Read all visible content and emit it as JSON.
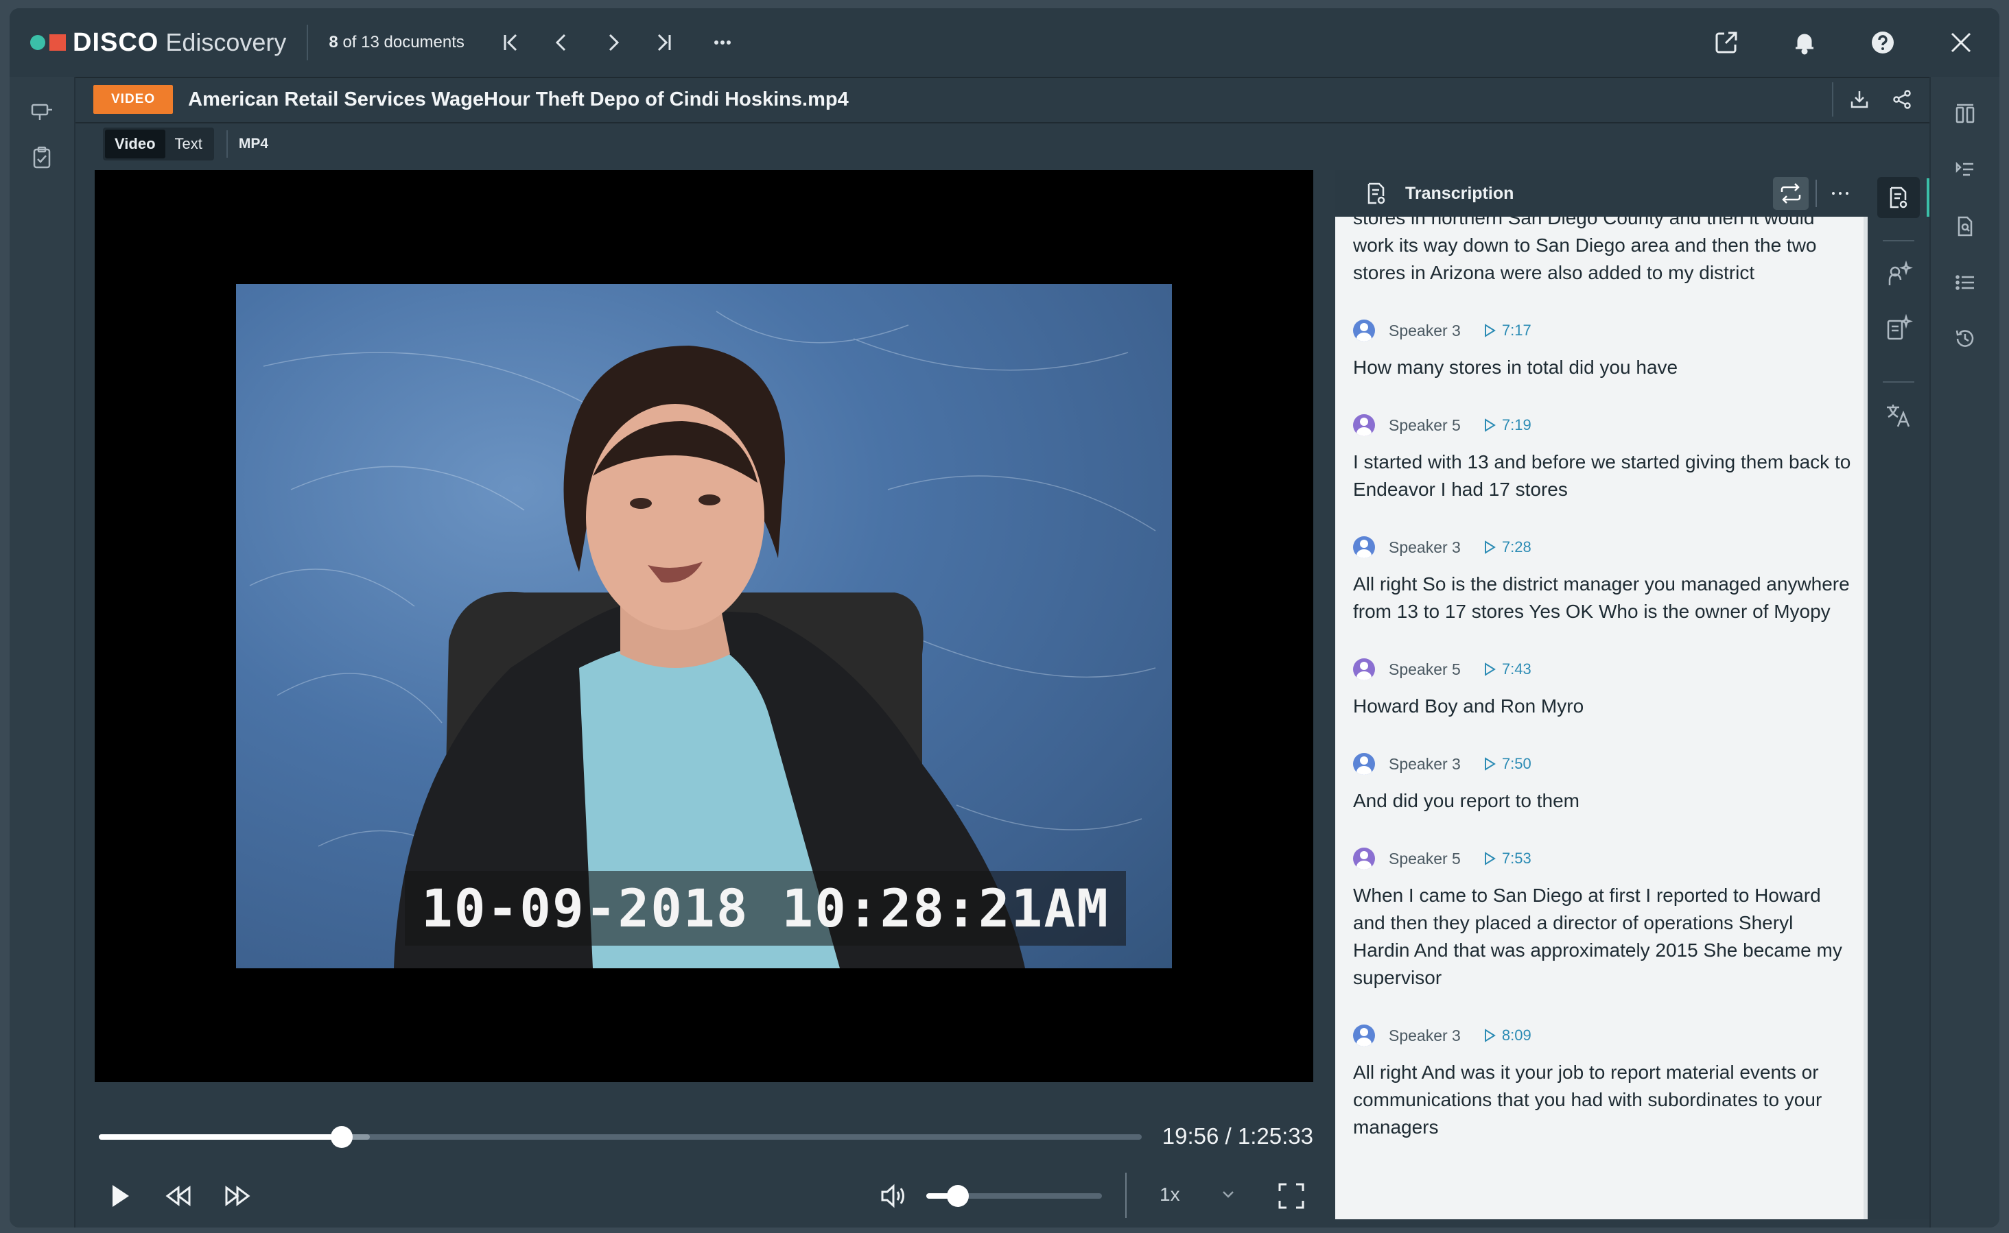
{
  "app": {
    "brand": "DISCO",
    "product": "Ediscovery",
    "doc_count_current": "8",
    "doc_count_text": " of 13 documents"
  },
  "colors": {
    "brand_teal": "#3bbfa8",
    "brand_red": "#e8543f",
    "video_badge": "#f07d2b",
    "timestamp_link": "#2b8bb4",
    "speaker3_avatar": "#5b84d6",
    "speaker5_avatar": "#8a6fd1"
  },
  "document": {
    "type_badge": "VIDEO",
    "title": "American Retail Services WageHour Theft Depo of Cindi Hoskins.mp4"
  },
  "view_tabs": [
    {
      "label": "Video",
      "active": true
    },
    {
      "label": "Text",
      "active": false
    }
  ],
  "format_label": "MP4",
  "video": {
    "burned_in_timestamp": "10-09-2018 10:28:21AM",
    "elapsed": "19:56",
    "duration": "1:25:33",
    "time_display": "19:56 / 1:25:33",
    "progress_fraction": 0.2331,
    "buffered_fraction": 0.26,
    "volume_fraction": 0.18,
    "speed": "1x"
  },
  "icons": {
    "top": [
      "first-page-icon",
      "previous-icon",
      "next-icon",
      "last-page-icon",
      "more-icon",
      "open-external-icon",
      "bell-icon",
      "help-icon",
      "close-icon"
    ],
    "left_rail": [
      "panel-toggle-icon",
      "clipboard-check-icon"
    ],
    "right_rail": [
      "columns-icon",
      "comments-icon",
      "document-search-icon",
      "list-icon",
      "history-icon"
    ],
    "panel_tools": [
      "transcription-icon",
      "speaker-ai-icon",
      "summary-ai-icon",
      "translate-icon"
    ]
  },
  "transcription": {
    "title": "Transcription",
    "lead_text": "stores in northern San Diego County and then it would work its way down to San Diego area and then the two stores in Arizona were also added to my district",
    "entries": [
      {
        "speaker": "Speaker 3",
        "time": "7:17",
        "text": "How many stores in total did you have"
      },
      {
        "speaker": "Speaker 5",
        "time": "7:19",
        "text": "I started with 13 and before we started giving them back to Endeavor I had 17 stores"
      },
      {
        "speaker": "Speaker 3",
        "time": "7:28",
        "text": "All right So is the district manager you managed anywhere from 13 to 17 stores Yes OK Who is the owner of Myopy"
      },
      {
        "speaker": "Speaker 5",
        "time": "7:43",
        "text": "Howard Boy and Ron Myro"
      },
      {
        "speaker": "Speaker 3",
        "time": "7:50",
        "text": "And did you report to them"
      },
      {
        "speaker": "Speaker 5",
        "time": "7:53",
        "text": "When I came to San Diego at first I reported to Howard and then they placed a director of operations Sheryl Hardin And that was approximately 2015 She became my supervisor"
      },
      {
        "speaker": "Speaker 3",
        "time": "8:09",
        "text": "All right And was it your job to report material events or communications that you had with subordinates to your managers"
      }
    ]
  }
}
